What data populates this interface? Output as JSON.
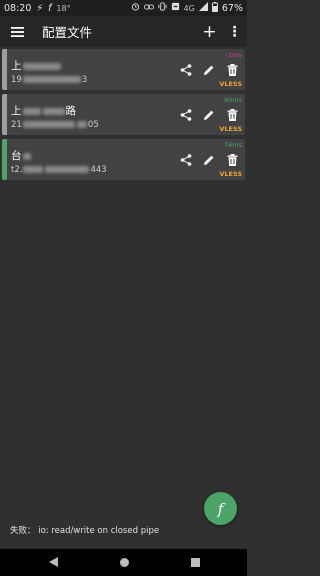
{
  "status_bar": {
    "time": "08:20",
    "temp": "18°",
    "network": "4G",
    "battery": "67%"
  },
  "toolbar": {
    "title": "配置文件",
    "add_label": "+",
    "more_label": "⋮"
  },
  "profiles": [
    {
      "name_prefix": "上",
      "name_suffix": "",
      "addr_prefix": "19",
      "addr_suffix": "3",
      "delay": "-1ms",
      "delay_color": "#d8409c",
      "protocol": "VLESS",
      "accent": "#9e9e9e"
    },
    {
      "name_prefix": "上",
      "name_suffix": "路",
      "addr_prefix": "21",
      "addr_suffix": "05",
      "delay": "90ms",
      "delay_color": "#4ca469",
      "protocol": "VLESS",
      "accent": "#9e9e9e"
    },
    {
      "name_prefix": "台",
      "name_suffix": "",
      "addr_prefix": "t2.",
      "addr_suffix": "443",
      "delay": "74ms",
      "delay_color": "#4ca469",
      "protocol": "VLESS",
      "accent": "#4ca469"
    }
  ],
  "protocol_color": "#f0a43a",
  "error_message": "失败： io: read/write on closed pipe",
  "fab_label": "f"
}
